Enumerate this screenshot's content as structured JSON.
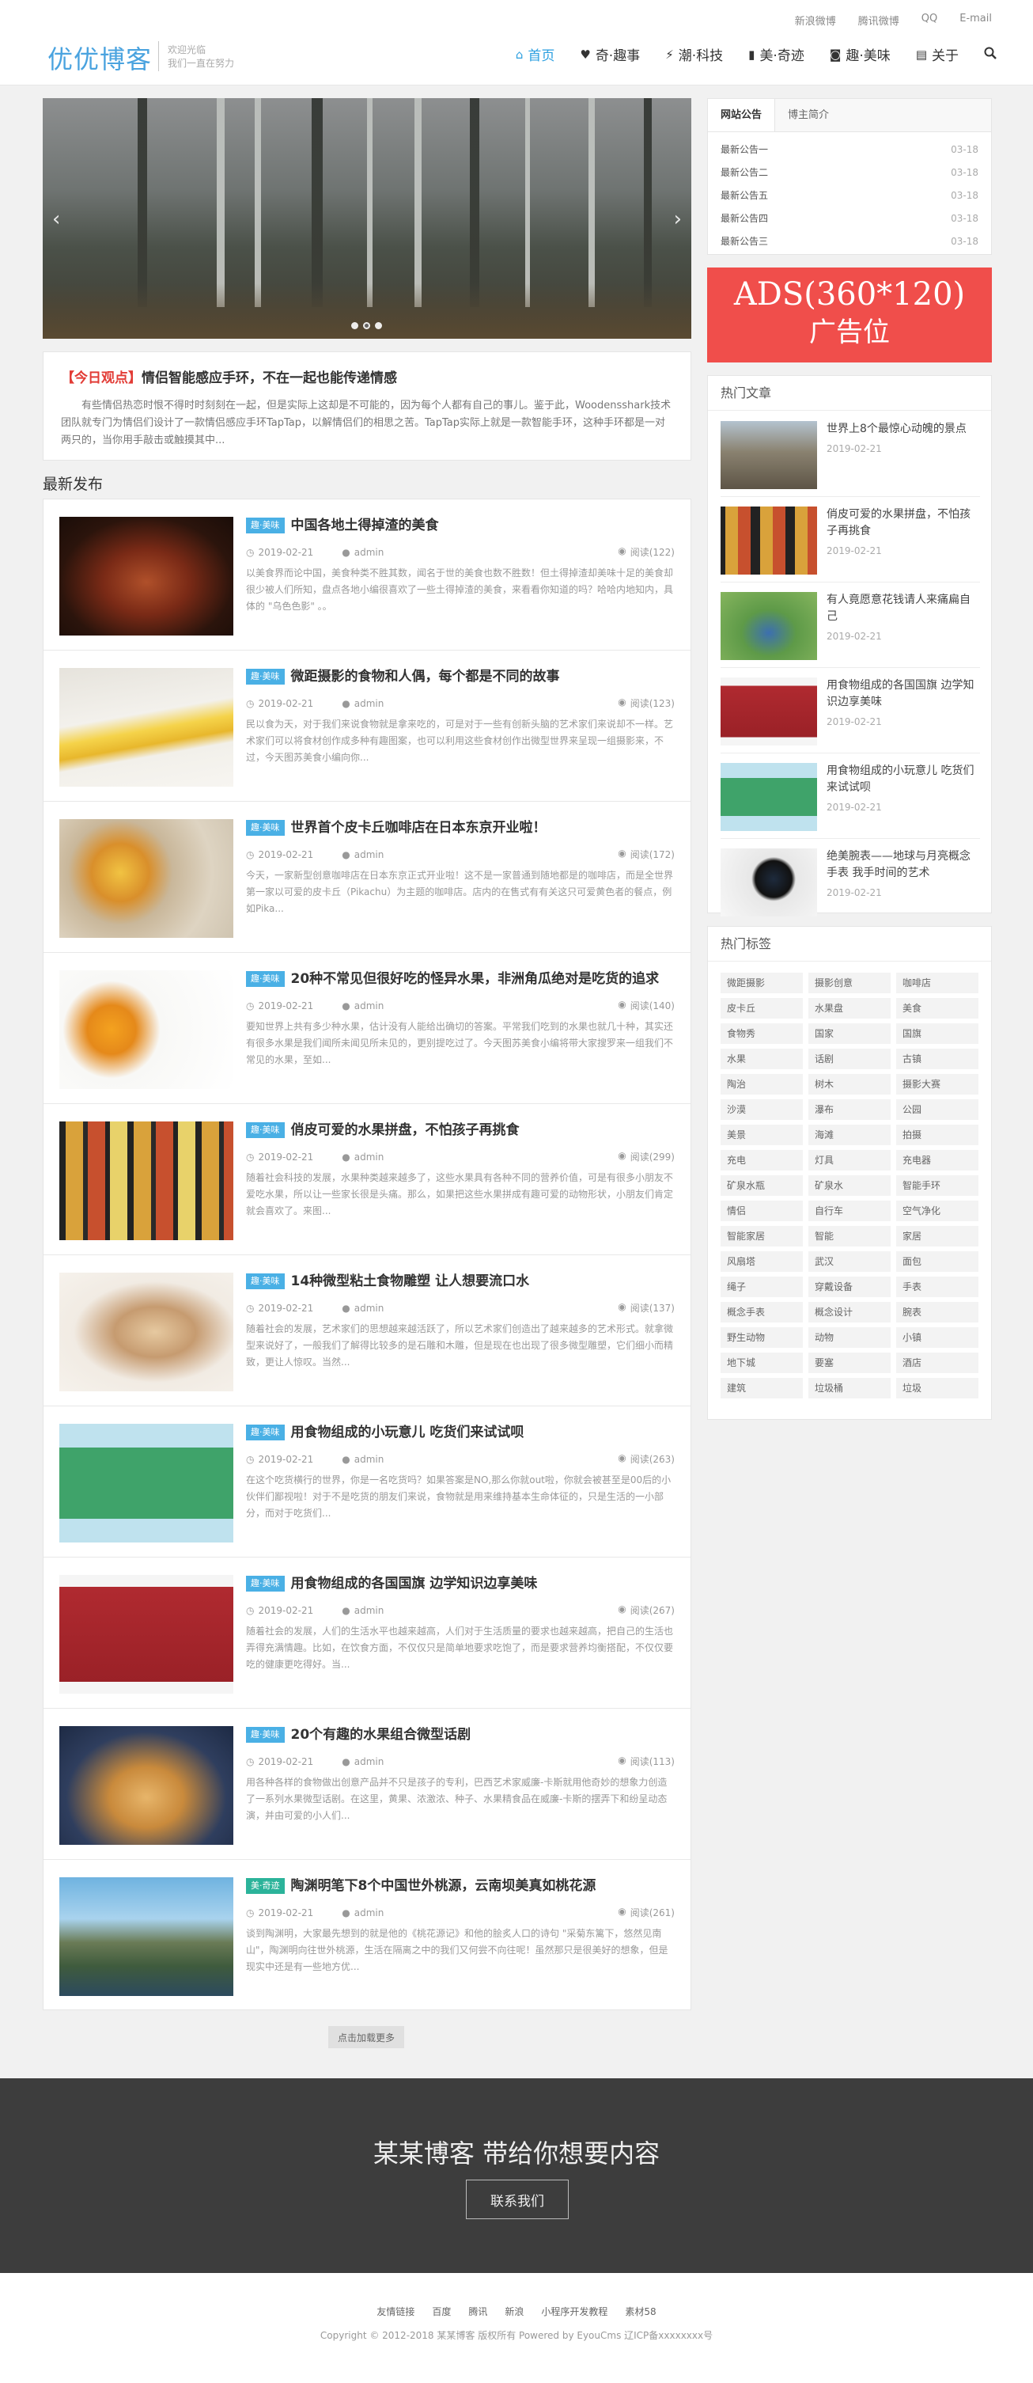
{
  "top_links": [
    "新浪微博",
    "腾讯微博",
    "QQ",
    "E-mail"
  ],
  "logo": {
    "main": "优优博客",
    "sub1": "欢迎光临",
    "sub2": "我们一直在努力"
  },
  "nav": [
    {
      "label": "首页",
      "icon": "home-icon"
    },
    {
      "label": "奇·趣事",
      "icon": "heart-icon"
    },
    {
      "label": "潮·科技",
      "icon": "plug-icon"
    },
    {
      "label": "美·奇迹",
      "icon": "book-icon"
    },
    {
      "label": "趣·美味",
      "icon": "camera-icon"
    },
    {
      "label": "关于",
      "icon": "bookmark-icon"
    }
  ],
  "today": {
    "tag": "【今日观点】",
    "title": "情侣智能感应手环，不在一起也能传递情感",
    "text": "有些情侣热恋时恨不得时时刻刻在一起，但是实际上这却是不可能的，因为每个人都有自己的事儿。鉴于此，Woodensshark技术团队就专门为情侣们设计了一款情侣感应手环TapTap，以解情侣们的相思之苦。TapTap实际上就是一款智能手环，这种手环都是一对两只的，当你用手敲击或触摸其中..."
  },
  "latest_title": "最新发布",
  "posts": [
    {
      "cat": "趣·美味",
      "title": "中国各地土得掉渣的美食",
      "date": "2019-02-21",
      "author": "admin",
      "views": "阅读(122)",
      "excerpt": "以美食界而论中国，美食种类不胜其数，闻名于世的美食也数不胜数！但土得掉渣却美味十足的美食却很少被人们所知，盘点各地小编很喜欢了一些土得掉渣的美食，来看看你知道的吗？哈哈内地知内，具体的 \"乌色色影\" 。。"
    },
    {
      "cat": "趣·美味",
      "title": "微距摄影的食物和人偶，每个都是不同的故事",
      "date": "2019-02-21",
      "author": "admin",
      "views": "阅读(123)",
      "excerpt": "民以食为天，对于我们来说食物就是拿来吃的，可是对于一些有创新头脑的艺术家们来说却不一样。艺术家们可以将食材创作成多种有趣图案，也可以利用这些食材创作出微型世界来呈现一组摄影来，不过，今天图苏美食小编向你..."
    },
    {
      "cat": "趣·美味",
      "title": "世界首个皮卡丘咖啡店在日本东京开业啦！",
      "date": "2019-02-21",
      "author": "admin",
      "views": "阅读(172)",
      "excerpt": "今天，一家新型创意咖啡店在日本东京正式开业啦！这不是一家普通到随地都是的咖啡店，而是全世界第一家以可爱的皮卡丘（Pikachu）为主题的咖啡店。店内的在售式有有关这只可爱黄色者的餐点，例如Pika..."
    },
    {
      "cat": "趣·美味",
      "title": "20种不常见但很好吃的怪异水果，非洲角瓜绝对是吃货的追求",
      "date": "2019-02-21",
      "author": "admin",
      "views": "阅读(140)",
      "excerpt": "要知世界上共有多少种水果，估计没有人能给出确切的答案。平常我们吃到的水果也就几十种，其实还有很多水果是我们闻所未闻见所未见的，更别提吃过了。今天图苏美食小编将带大家搜罗来一组我们不常见的水果，至如..."
    },
    {
      "cat": "趣·美味",
      "title": "俏皮可爱的水果拼盘，不怕孩子再挑食",
      "date": "2019-02-21",
      "author": "admin",
      "views": "阅读(299)",
      "excerpt": "随着社会科技的发展，水果种类越来越多了，这些水果具有各种不同的营养价值，可是有很多小朋友不爱吃水果，所以让一些家长很是头痛。那么，如果把这些水果拼成有趣可爱的动物形状，小朋友们肯定就会喜欢了。来图..."
    },
    {
      "cat": "趣·美味",
      "title": "14种微型粘土食物雕塑 让人想要流口水",
      "date": "2019-02-21",
      "author": "admin",
      "views": "阅读(137)",
      "excerpt": "随着社会的发展，艺术家们的思想越来越活跃了，所以艺术家们创造出了越来越多的艺术形式。就拿微型来说好了，一般我们了解得比较多的是石雕和木雕，但是现在也出现了很多微型雕塑，它们细小而精致，更让人惊叹。当然..."
    },
    {
      "cat": "趣·美味",
      "title": "用食物组成的小玩意儿 吃货们来试试呗",
      "date": "2019-02-21",
      "author": "admin",
      "views": "阅读(263)",
      "excerpt": "在这个吃货横行的世界，你是一名吃货吗？如果答案是NO,那么你就out啦，你就会被甚至是00后的小伙伴们鄙视啦！对于不是吃货的朋友们来说，食物就是用来维持基本生命体征的，只是生活的一小部分，而对于吃货们..."
    },
    {
      "cat": "趣·美味",
      "title": "用食物组成的各国国旗 边学知识边享美味",
      "date": "2019-02-21",
      "author": "admin",
      "views": "阅读(267)",
      "excerpt": "随着社会的发展，人们的生活水平也越来越高，人们对于生活质量的要求也越来越高，把自己的生活也弄得充满情趣。比如，在饮食方面，不仅仅只是简单地要求吃饱了，而是要求营养均衡搭配，不仅仅要吃的健康更吃得好。当..."
    },
    {
      "cat": "趣·美味",
      "title": "20个有趣的水果组合微型话剧",
      "date": "2019-02-21",
      "author": "admin",
      "views": "阅读(113)",
      "excerpt": "用各种各样的食物做出创意产品并不只是孩子的专利，巴西艺术家威廉-卡斯就用他奇妙的想象力创造了一系列水果微型话剧。在这里，黄果、浓激浓、种子、水果精食品在威廉-卡斯的摆弄下和纷呈动态演，并由可爱的小人们..."
    },
    {
      "cat": "美·奇迹",
      "title": "陶渊明笔下8个中国世外桃源，云南坝美真如桃花源",
      "date": "2019-02-21",
      "author": "admin",
      "views": "阅读(261)",
      "excerpt": "谈到陶渊明，大家最先想到的就是他的《桃花源记》和他的脍炙人口的诗句 \"采菊东篱下，悠然见南山\"，陶渊明向往世外桃源，生活在隔离之中的我们又何尝不向往呢！虽然那只是很美好的想象，但是现实中还是有一些地方优..."
    }
  ],
  "load_more": "点击加载更多",
  "notice": {
    "tabs": [
      "网站公告",
      "博主简介"
    ],
    "items": [
      {
        "title": "最新公告一",
        "date": "03-18"
      },
      {
        "title": "最新公告二",
        "date": "03-18"
      },
      {
        "title": "最新公告五",
        "date": "03-18"
      },
      {
        "title": "最新公告四",
        "date": "03-18"
      },
      {
        "title": "最新公告三",
        "date": "03-18"
      }
    ]
  },
  "ads": {
    "line1": "ADS(360*120)",
    "line2": "广告位"
  },
  "hot": {
    "title": "热门文章",
    "items": [
      {
        "title": "世界上8个最惊心动魄的景点",
        "date": "2019-02-21"
      },
      {
        "title": "俏皮可爱的水果拼盘，不怕孩子再挑食",
        "date": "2019-02-21"
      },
      {
        "title": "有人竟愿意花钱请人来痛扁自己",
        "date": "2019-02-21"
      },
      {
        "title": "用食物组成的各国国旗 边学知识边享美味",
        "date": "2019-02-21"
      },
      {
        "title": "用食物组成的小玩意儿 吃货们来试试呗",
        "date": "2019-02-21"
      },
      {
        "title": "绝美腕表——地球与月亮概念手表 我手时间的艺术",
        "date": "2019-02-21"
      }
    ]
  },
  "tags": {
    "title": "热门标签",
    "items": [
      "微距摄影",
      "摄影创意",
      "咖啡店",
      "皮卡丘",
      "水果盘",
      "美食",
      "食物秀",
      "国家",
      "国旗",
      "水果",
      "话剧",
      "古镇",
      "陶治",
      "树木",
      "摄影大赛",
      "沙漠",
      "瀑布",
      "公园",
      "美景",
      "海滩",
      "拍摄",
      "充电",
      "灯具",
      "充电器",
      "矿泉水瓶",
      "矿泉水",
      "智能手环",
      "情侣",
      "自行车",
      "空气净化",
      "智能家居",
      "智能",
      "家居",
      "风扇塔",
      "武汉",
      "面包",
      "绳子",
      "穿戴设备",
      "手表",
      "概念手表",
      "概念设计",
      "腕表",
      "野生动物",
      "动物",
      "小镇",
      "地下城",
      "要塞",
      "酒店",
      "建筑",
      "垃圾桶",
      "垃圾"
    ]
  },
  "banner": {
    "title": "某某博客 带给你想要内容",
    "button": "联系我们"
  },
  "footer": {
    "links": [
      "友情链接",
      "百度",
      "腾讯",
      "新浪",
      "小程序开发教程",
      "素材58"
    ],
    "copyright": "Copyright © 2012-2018 某某博客 版权所有 Powered by EyouCms 辽ICP备xxxxxxxx号"
  }
}
